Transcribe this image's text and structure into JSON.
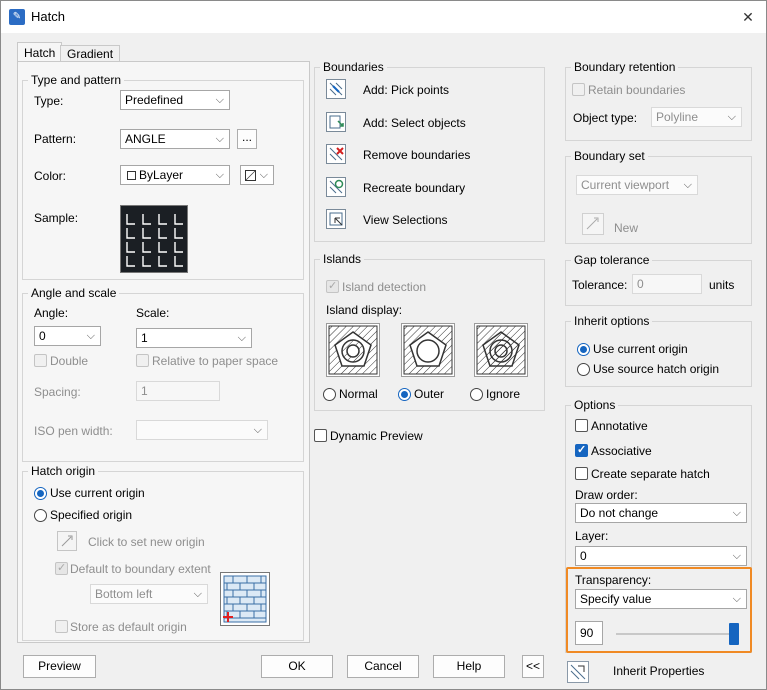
{
  "window": {
    "title": "Hatch",
    "close_glyph": "✕",
    "app_icon": "hatch-app-icon"
  },
  "tabs": [
    "Hatch",
    "Gradient"
  ],
  "type_and_pattern": {
    "heading": "Type and pattern",
    "type_label": "Type:",
    "type_value": "Predefined",
    "pattern_label": "Pattern:",
    "pattern_value": "ANGLE",
    "pattern_browse": "...",
    "color_label": "Color:",
    "color_value": "ByLayer",
    "sample_label": "Sample:"
  },
  "angle_and_scale": {
    "heading": "Angle and scale",
    "angle_label": "Angle:",
    "angle_value": "0",
    "scale_label": "Scale:",
    "scale_value": "1",
    "double_label": "Double",
    "relative_label": "Relative to paper space",
    "spacing_label": "Spacing:",
    "spacing_value": "1",
    "iso_label": "ISO pen width:"
  },
  "hatch_origin": {
    "heading": "Hatch origin",
    "use_current": "Use current origin",
    "specified": "Specified origin",
    "click_to_set": "Click to set new origin",
    "default_extent": "Default to boundary extent",
    "position_value": "Bottom left",
    "store_default": "Store as default origin"
  },
  "boundaries": {
    "heading": "Boundaries",
    "items": [
      "Add: Pick points",
      "Add: Select objects",
      "Remove boundaries",
      "Recreate boundary",
      "View Selections"
    ]
  },
  "islands": {
    "heading": "Islands",
    "detection_label": "Island detection",
    "display_label": "Island display:",
    "options": [
      "Normal",
      "Outer",
      "Ignore"
    ]
  },
  "dynamic_preview_label": "Dynamic Preview",
  "boundary_retention": {
    "heading": "Boundary retention",
    "retain_label": "Retain boundaries",
    "object_type_label": "Object type:",
    "object_type_value": "Polyline"
  },
  "boundary_set": {
    "heading": "Boundary set",
    "value": "Current viewport",
    "new_label": "New"
  },
  "gap_tolerance": {
    "heading": "Gap tolerance",
    "tolerance_label": "Tolerance:",
    "value": "0",
    "units": "units"
  },
  "inherit_options": {
    "heading": "Inherit options",
    "use_current": "Use current origin",
    "use_source": "Use source hatch origin"
  },
  "options": {
    "heading": "Options",
    "annotative": "Annotative",
    "associative": "Associative",
    "separate": "Create separate hatch",
    "draw_order_label": "Draw order:",
    "draw_order_value": "Do not change",
    "layer_label": "Layer:",
    "layer_value": "0",
    "transparency_label": "Transparency:",
    "transparency_value": "Specify value",
    "transparency_number": "90",
    "transparency_level_percent": 90
  },
  "inherit_properties_label": "Inherit Properties",
  "footer": {
    "preview": "Preview",
    "ok": "OK",
    "cancel": "Cancel",
    "help": "Help",
    "collapse": "<<"
  },
  "colors": {
    "accent": "#1565c0",
    "highlight": "#f08a24"
  }
}
